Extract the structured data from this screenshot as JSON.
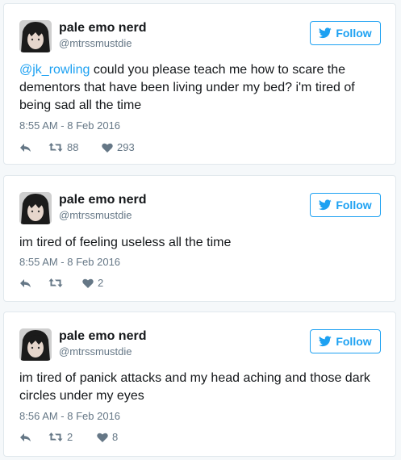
{
  "colors": {
    "accent": "#1da1f2",
    "text": "#14171a",
    "muted": "#657786",
    "border": "#e1e8ed"
  },
  "follow_label": "Follow",
  "icons": {
    "follow": "twitter-bird-icon",
    "reply": "reply-icon",
    "retweet": "retweet-icon",
    "like": "heart-icon"
  },
  "tweets": [
    {
      "name": "pale emo nerd",
      "handle": "@mtrssmustdie",
      "mention": "@jk_rowling",
      "text": " could you please teach me how to scare the dementors that have been living under my bed? i'm tired of being sad all the time",
      "time": "8:55 AM - 8 Feb 2016",
      "retweets": "88",
      "likes": "293"
    },
    {
      "name": "pale emo nerd",
      "handle": "@mtrssmustdie",
      "text": "im tired of feeling useless all the time",
      "time": "8:55 AM - 8 Feb 2016",
      "retweets": "",
      "likes": "2"
    },
    {
      "name": "pale emo nerd",
      "handle": "@mtrssmustdie",
      "text": "im tired of panick attacks and my head aching and those dark circles under my eyes",
      "time": "8:56 AM - 8 Feb 2016",
      "retweets": "2",
      "likes": "8"
    }
  ]
}
